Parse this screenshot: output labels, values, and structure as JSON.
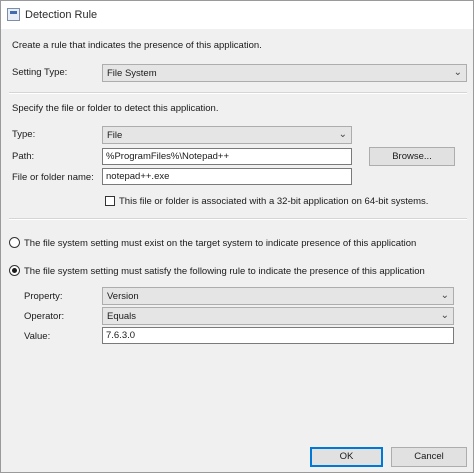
{
  "window": {
    "title": "Detection Rule"
  },
  "intro_text": "Create a rule that indicates the presence of this application.",
  "setting_type": {
    "label": "Setting Type:",
    "value": "File System"
  },
  "detect_text": "Specify the file or folder to detect this application.",
  "type": {
    "label": "Type:",
    "value": "File"
  },
  "path": {
    "label": "Path:",
    "value": "%ProgramFiles%\\Notepad++",
    "browse_label": "Browse..."
  },
  "file_name": {
    "label": "File or folder name:",
    "value": "notepad++.exe"
  },
  "bit32_checkbox": {
    "label": "This file or folder is associated with a 32-bit application on 64-bit systems.",
    "checked": false
  },
  "radio_exist": {
    "label": "The file system setting must exist on the target system to indicate presence of this application",
    "selected": false
  },
  "radio_rule": {
    "label": "The file system setting must satisfy the following rule to indicate the presence of this application",
    "selected": true
  },
  "property": {
    "label": "Property:",
    "value": "Version"
  },
  "operator": {
    "label": "Operator:",
    "value": "Equals"
  },
  "value_field": {
    "label": "Value:",
    "value": "7.6.3.0"
  },
  "buttons": {
    "ok": "OK",
    "cancel": "Cancel"
  }
}
